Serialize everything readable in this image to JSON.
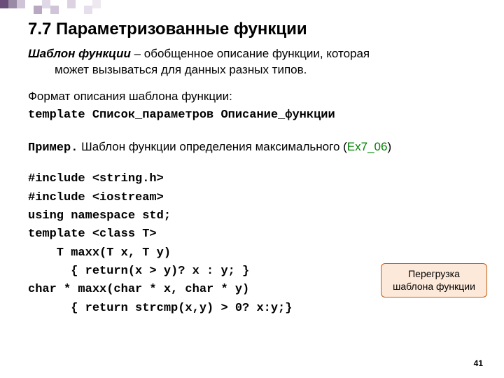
{
  "heading": "7.7 Параметризованные функции",
  "definition": {
    "term": "Шаблон функции",
    "dash": " – ",
    "line1": "обобщенное описание функции, которая",
    "line2": "может вызываться для данных разных типов."
  },
  "format_label": "Формат описания шаблона функции:",
  "format_code": "template Список_параметров Описание_функции",
  "example": {
    "label": "Пример.",
    "text": "  Шаблон функции определения максимального (",
    "ref": "Ex7_06",
    "close": ")"
  },
  "code": {
    "l1": "#include <string.h>",
    "l2": "#include <iostream>",
    "l3": "using namespace std;",
    "l4": "template <class T>",
    "l5": "    T maxx(T x, T y)",
    "l6": "      { return(x > y)? x : y; }",
    "l7": "char * maxx(char * x, char * y)",
    "l8": "      { return strcmp(x,y) > 0? x:y;}"
  },
  "callout": {
    "line1": "Перегрузка",
    "line2": "шаблона функции"
  },
  "page_number": "41"
}
